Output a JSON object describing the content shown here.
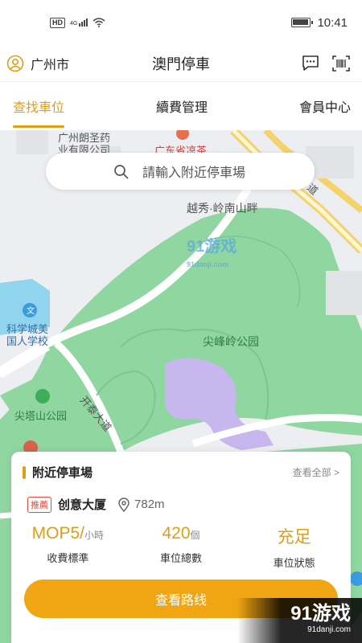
{
  "status_bar": {
    "network": "HD",
    "signal": "4G",
    "time": "10:41",
    "battery_level": 0.9
  },
  "header": {
    "city": "广州市",
    "title": "澳門停車"
  },
  "tabs": [
    {
      "label": "查找車位",
      "active": true
    },
    {
      "label": "續費管理",
      "active": false
    },
    {
      "label": "會員中心",
      "active": false
    }
  ],
  "search": {
    "placeholder": "請輸入附近停車場"
  },
  "map_labels": {
    "company": "广州朗圣药\n业有限公司",
    "province": "广东省凉茶",
    "road_dao": "道",
    "residence": "越秀·岭南山畔",
    "school": "科学城美\n国人学校",
    "park": "尖峰岭公园",
    "road_kaitai": "开泰大道",
    "station": "尖塔山公园",
    "watermark_main": "91游戏",
    "watermark_sub": "91danji.com"
  },
  "nearby": {
    "title": "附近停車場",
    "see_all": "查看全部 >",
    "badge": "推薦",
    "lot_name": "创意大厦",
    "distance": "782m",
    "price_value": "MOP5/",
    "price_unit": "小時",
    "price_label": "收費標準",
    "spaces_value": "420",
    "spaces_unit": "個",
    "spaces_label": "車位總數",
    "status_value": "充足",
    "status_label": "車位狀態",
    "route_button": "查看路线"
  },
  "colors": {
    "accent": "#e09e17",
    "button": "#f0a512",
    "park_green": "#8fd6a0",
    "map_bg": "#eceef1"
  }
}
